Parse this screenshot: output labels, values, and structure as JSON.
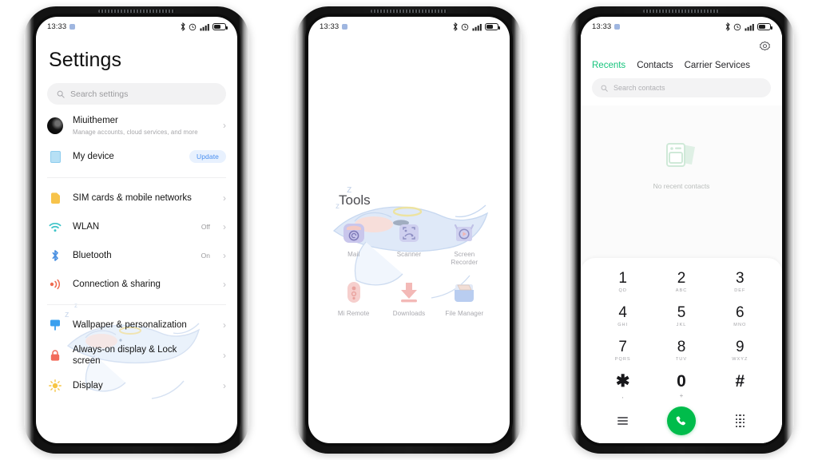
{
  "statusbar": {
    "time": "13:33",
    "icons": [
      "bluetooth-icon",
      "alarm-icon",
      "signal-icon",
      "battery-icon"
    ]
  },
  "settings": {
    "title": "Settings",
    "search": {
      "placeholder": "Search settings",
      "icon": "search-icon"
    },
    "account": {
      "name": "Miuithemer",
      "subtitle": "Manage accounts, cloud services, and more",
      "chevron": "›"
    },
    "device": {
      "label": "My device",
      "badge": "Update",
      "icon_color": "#a7dbf2"
    },
    "items": [
      {
        "label": "SIM cards & mobile networks",
        "value": "",
        "icon": "sim-card-icon",
        "color": "#f5b942",
        "chevron": "›"
      },
      {
        "label": "WLAN",
        "value": "Off",
        "icon": "wifi-icon",
        "color": "#3fc4c8",
        "chevron": "›"
      },
      {
        "label": "Bluetooth",
        "value": "On",
        "icon": "bluetooth-icon",
        "color": "#4a90e2",
        "chevron": "›"
      },
      {
        "label": "Connection & sharing",
        "value": "",
        "icon": "connection-sharing-icon",
        "color": "#ef6b4f",
        "chevron": "›"
      },
      {
        "label": "Wallpaper & personalization",
        "value": "",
        "icon": "wallpaper-icon",
        "color": "#3aa0ef",
        "chevron": "›"
      },
      {
        "label": "Always-on display & Lock screen",
        "value": "",
        "icon": "lock-icon",
        "color": "#f26b5b",
        "chevron": "›"
      },
      {
        "label": "Display",
        "value": "",
        "icon": "brightness-icon",
        "color": "#f6c544",
        "chevron": "›"
      }
    ]
  },
  "tools": {
    "folder_title": "Tools",
    "apps": [
      {
        "name": "Mail",
        "icon": "mail-app-icon"
      },
      {
        "name": "Scanner",
        "icon": "scanner-app-icon"
      },
      {
        "name": "Screen Recorder",
        "icon": "screen-recorder-app-icon"
      },
      {
        "name": "Mi Remote",
        "icon": "mi-remote-app-icon"
      },
      {
        "name": "Downloads",
        "icon": "downloads-app-icon"
      },
      {
        "name": "File Manager",
        "icon": "file-manager-app-icon"
      }
    ]
  },
  "dialer": {
    "settings_icon": "gear-icon",
    "tabs": [
      {
        "label": "Recents",
        "active": true
      },
      {
        "label": "Contacts",
        "active": false
      },
      {
        "label": "Carrier Services",
        "active": false
      }
    ],
    "accent_color": "#17c47d",
    "search": {
      "placeholder": "Search contacts",
      "icon": "search-icon"
    },
    "empty": {
      "text": "No recent contacts",
      "icon": "contacts-empty-icon"
    },
    "keys": [
      {
        "digit": "1",
        "letters": "QD"
      },
      {
        "digit": "2",
        "letters": "ABC"
      },
      {
        "digit": "3",
        "letters": "DEF"
      },
      {
        "digit": "4",
        "letters": "GHI"
      },
      {
        "digit": "5",
        "letters": "JKL"
      },
      {
        "digit": "6",
        "letters": "MNO"
      },
      {
        "digit": "7",
        "letters": "PQRS"
      },
      {
        "digit": "8",
        "letters": "TUV"
      },
      {
        "digit": "9",
        "letters": "WXYZ"
      },
      {
        "digit": "✱",
        "letters": ",",
        "symbol": true
      },
      {
        "digit": "0",
        "letters": "+",
        "symbol": true
      },
      {
        "digit": "#",
        "letters": "",
        "symbol": true
      }
    ],
    "actions": {
      "menu_icon": "menu-icon",
      "call_icon": "call-icon",
      "keypad_icon": "keypad-icon",
      "call_color": "#00bc4b"
    }
  }
}
